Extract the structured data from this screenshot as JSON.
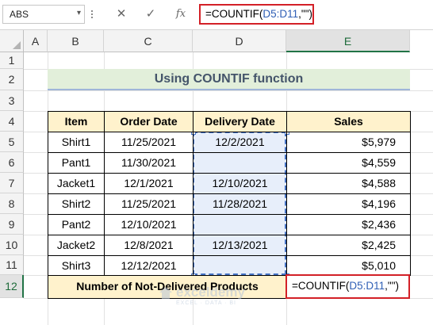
{
  "name_box": "ABS",
  "formula_bar": {
    "cancel_icon": "✕",
    "enter_icon": "✓",
    "fx_label": "fx",
    "formula_prefix": "=COUNTIF(",
    "formula_ref": "D5:D11",
    "formula_suffix": ",\"\")"
  },
  "columns": [
    "A",
    "B",
    "C",
    "D",
    "E"
  ],
  "rows": [
    "1",
    "2",
    "3",
    "4",
    "5",
    "6",
    "7",
    "8",
    "9",
    "10",
    "11",
    "12"
  ],
  "selected_column": "E",
  "selected_row": "12",
  "sheet": {
    "title": "Using COUNTIF function",
    "headers": [
      "Item",
      "Order Date",
      "Delivery Date",
      "Sales"
    ],
    "data": [
      [
        "Shirt1",
        "11/25/2021",
        "12/2/2021",
        "$5,979"
      ],
      [
        "Pant1",
        "11/30/2021",
        "",
        "$4,559"
      ],
      [
        "Jacket1",
        "12/1/2021",
        "12/10/2021",
        "$4,588"
      ],
      [
        "Shirt2",
        "11/25/2021",
        "11/28/2021",
        "$4,196"
      ],
      [
        "Pant2",
        "12/10/2021",
        "",
        "$2,436"
      ],
      [
        "Jacket2",
        "12/8/2021",
        "12/13/2021",
        "$2,425"
      ],
      [
        "Shirt3",
        "12/12/2021",
        "",
        "$5,010"
      ]
    ],
    "footer_label": "Number of Not-Delivered Products",
    "footer_formula_prefix": "=COUNTIF(",
    "footer_formula_ref": "D5:D11",
    "footer_formula_suffix": ",\"\")"
  },
  "watermark": {
    "brand": "exceldemy",
    "tagline": "EXCEL · DATA · BI"
  },
  "colors": {
    "title_fill": "#e2efda",
    "header_fill": "#fff2cc",
    "highlight": "#d32027",
    "range_ref": "#2f5fb5"
  }
}
